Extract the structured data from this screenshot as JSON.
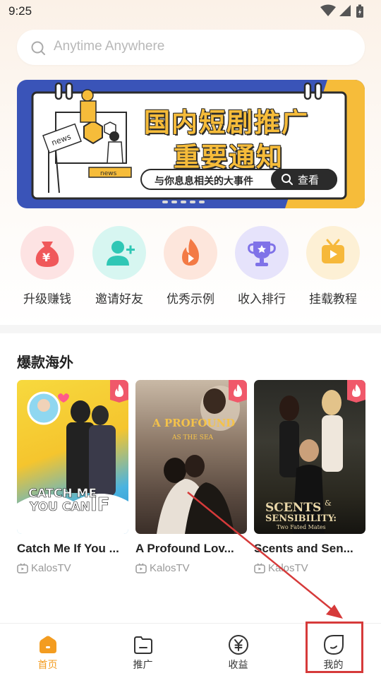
{
  "status_bar": {
    "time": "9:25"
  },
  "search": {
    "placeholder": "Anytime Anywhere"
  },
  "banner": {
    "line1": "国内短剧推广",
    "line2": "重要通知",
    "subtitle": "与你息息相关的大事件",
    "button_label": "查看",
    "badge_text": "news"
  },
  "quick_actions": [
    {
      "label": "升级赚钱",
      "icon": "money-bag-icon",
      "color": "#f0585a"
    },
    {
      "label": "邀请好友",
      "icon": "add-friend-icon",
      "color": "#2fc7b5"
    },
    {
      "label": "优秀示例",
      "icon": "flame-icon",
      "color": "#f37a45"
    },
    {
      "label": "收入排行",
      "icon": "trophy-icon",
      "color": "#7f72e8"
    },
    {
      "label": "挂载教程",
      "icon": "tv-icon",
      "color": "#f6b83a"
    }
  ],
  "section": {
    "title": "爆款海外"
  },
  "cards": [
    {
      "title": "Catch Me If You ...",
      "source": "KalosTV",
      "poster_text": "CATCH ME IF YOU CAN"
    },
    {
      "title": "A Profound Lov...",
      "source": "KalosTV",
      "poster_text": "A PROFOUND",
      "poster_sub": "AS THE SEA"
    },
    {
      "title": "Scents and Sen...",
      "source": "KalosTV",
      "poster_text": "SCENTS & SENSIBILITY:",
      "poster_sub": "Two Fated Mates"
    }
  ],
  "tabbar": [
    {
      "label": "首页",
      "active": true
    },
    {
      "label": "推广",
      "active": false
    },
    {
      "label": "收益",
      "active": false
    },
    {
      "label": "我的",
      "active": false
    }
  ],
  "colors": {
    "accent": "#f39c20",
    "banner_blue": "#3a54b8",
    "banner_yellow": "#f6bc3a",
    "annotation_red": "#d63a3a"
  }
}
